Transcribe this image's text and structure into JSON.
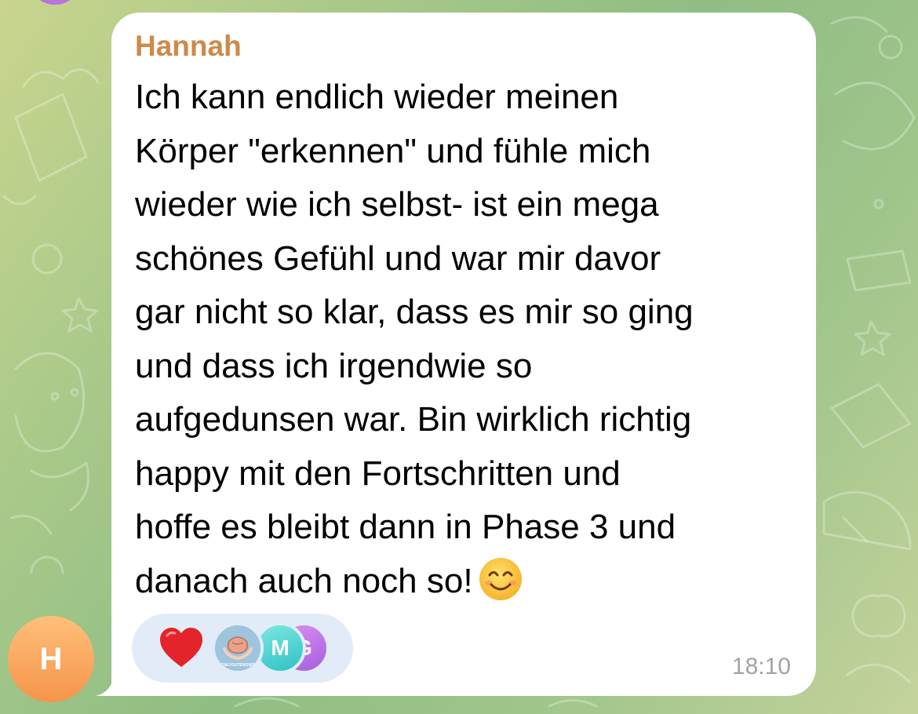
{
  "chat": {
    "message": {
      "sender": "Hannah",
      "text": "Ich kann endlich wieder meinen\nKörper \"erkennen\" und fühle mich\nwieder wie ich selbst- ist ein mega\nschönes Gefühl und war mir davor\ngar nicht so klar, dass es mir so ging\nund dass ich irgendwie so\naufgedunsen war. Bin wirklich richtig\nhappy mit den Fortschritten und\nhoffe es bleibt dann in Phase 3 und\ndanach auch noch so!",
      "emoji_icon": "smiling-face-emoji",
      "time": "18:10",
      "avatar_initial": "H",
      "avatar_colors": [
        "#ffbf7a",
        "#f5954b"
      ],
      "sender_color": "#cd8a4a"
    },
    "reactions": {
      "emoji_icon": "red-heart-emoji",
      "reactor_avatars": [
        {
          "kind": "logo",
          "icon": "onlygutenows-logo",
          "logo_text": "ONLYGUTENOWS"
        },
        {
          "kind": "initials",
          "text": "M",
          "color": "#2fc1c6"
        },
        {
          "kind": "initials",
          "text": "G",
          "color": "#a55fe0"
        }
      ]
    }
  }
}
